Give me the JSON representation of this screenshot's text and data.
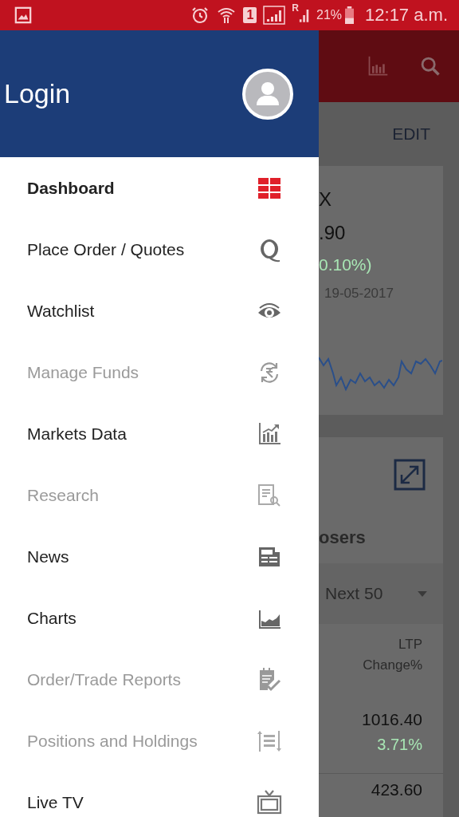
{
  "status_bar": {
    "sim_slot": "1",
    "roaming": "R",
    "battery": "21%",
    "time": "12:17 a.m."
  },
  "drawer": {
    "title": "Login",
    "items": [
      {
        "label": "Dashboard",
        "kind": "grid",
        "selected": true,
        "disabled": false
      },
      {
        "label": "Place Order / Quotes",
        "kind": "quote",
        "selected": false,
        "disabled": false
      },
      {
        "label": "Watchlist",
        "kind": "eye",
        "selected": false,
        "disabled": false
      },
      {
        "label": "Manage Funds",
        "kind": "funds",
        "selected": false,
        "disabled": true
      },
      {
        "label": "Markets Data",
        "kind": "bars",
        "selected": false,
        "disabled": false
      },
      {
        "label": "Research",
        "kind": "research",
        "selected": false,
        "disabled": true
      },
      {
        "label": "News",
        "kind": "news",
        "selected": false,
        "disabled": false
      },
      {
        "label": "Charts",
        "kind": "area",
        "selected": false,
        "disabled": false
      },
      {
        "label": "Order/Trade Reports",
        "kind": "report",
        "selected": false,
        "disabled": true
      },
      {
        "label": "Positions and Holdings",
        "kind": "positions",
        "selected": false,
        "disabled": true
      },
      {
        "label": "Live TV",
        "kind": "tv",
        "selected": false,
        "disabled": false
      }
    ]
  },
  "background": {
    "edit": "EDIT",
    "index_card": {
      "name": "X",
      "value": ".90",
      "change": "0.10%)",
      "date": "19-05-2017"
    },
    "movers_card": {
      "title": "osers",
      "filter": "Next 50",
      "col_1": "LTP",
      "col_2": "Change%",
      "rows": [
        {
          "ltp": "1016.40",
          "change": "3.71%"
        },
        {
          "ltp": "423.60"
        }
      ]
    }
  }
}
